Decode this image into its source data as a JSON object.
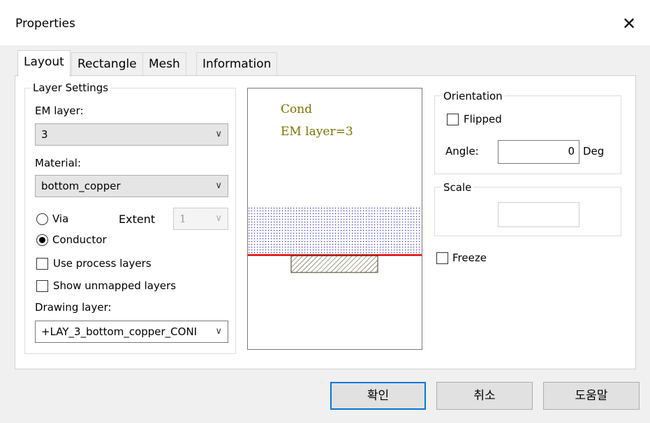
{
  "window": {
    "title": "Properties",
    "close_glyph": "✕"
  },
  "tabs": [
    {
      "label": "Layout"
    },
    {
      "label": "Rectangle"
    },
    {
      "label": "Mesh"
    },
    {
      "label": "Information"
    }
  ],
  "layer_settings": {
    "group_label": "Layer Settings",
    "em_layer_label": "EM layer:",
    "em_layer_value": "3",
    "material_label": "Material:",
    "material_value": "bottom_copper",
    "via_label": "Via",
    "extent_label": "Extent",
    "extent_value": "1",
    "conductor_label": "Conductor",
    "selected_type": "Conductor",
    "use_process_label": "Use process layers",
    "use_process_checked": false,
    "show_unmapped_label": "Show unmapped layers",
    "show_unmapped_checked": false,
    "drawing_layer_label": "Drawing layer:",
    "drawing_layer_value": "+LAY_3_bottom_copper_CONI"
  },
  "preview": {
    "line1": "Cond",
    "line2": "EM layer=3",
    "colors": {
      "text": "#7a7400",
      "substrate_dots": "#2a2ab0",
      "layer_line": "#e00000",
      "conductor": "#3d3a1a"
    }
  },
  "orientation": {
    "group_label": "Orientation",
    "flipped_label": "Flipped",
    "flipped_checked": false,
    "angle_label": "Angle:",
    "angle_value": "0",
    "angle_unit": "Deg"
  },
  "scale": {
    "group_label": "Scale",
    "value": ""
  },
  "freeze": {
    "label": "Freeze",
    "checked": false
  },
  "buttons": {
    "ok": "확인",
    "cancel": "취소",
    "help": "도움말"
  },
  "colors": {
    "accent": "#0078d7",
    "dialog_bg": "#f0f0f0"
  },
  "icons": {
    "chevron": "chevron-down-icon",
    "close": "close-icon"
  }
}
